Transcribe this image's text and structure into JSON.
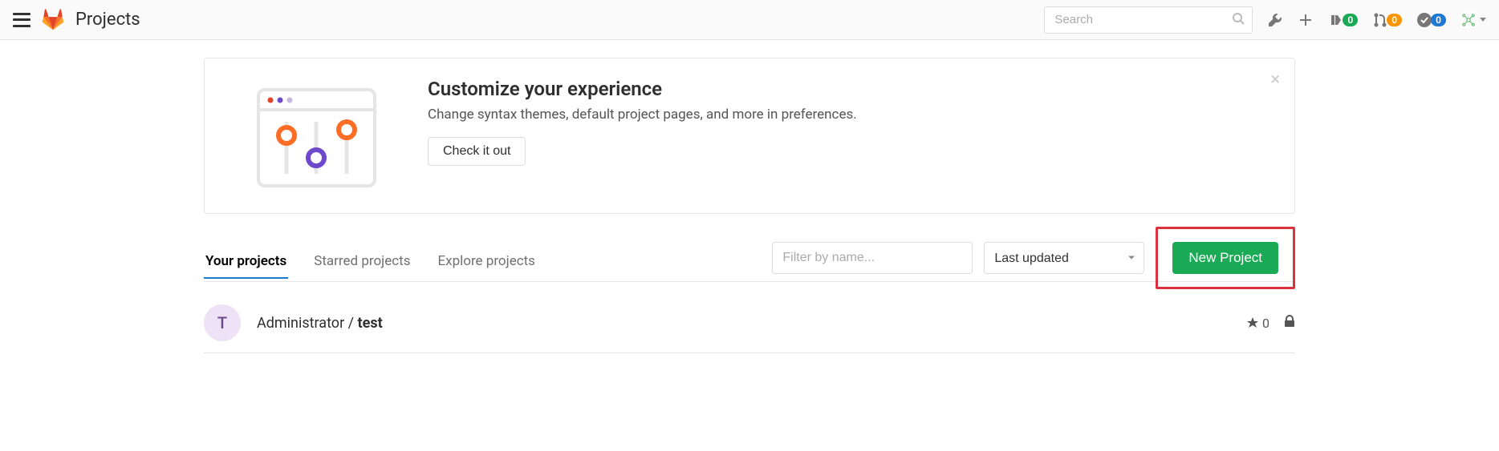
{
  "header": {
    "page_title": "Projects",
    "search_placeholder": "Search",
    "badges": {
      "issues": "0",
      "merge_requests": "0",
      "todos": "0"
    }
  },
  "banner": {
    "title": "Customize your experience",
    "desc": "Change syntax themes, default project pages, and more in preferences.",
    "button": "Check it out"
  },
  "tabs": {
    "your_projects": "Your projects",
    "starred_projects": "Starred projects",
    "explore_projects": "Explore projects"
  },
  "controls": {
    "filter_placeholder": "Filter by name...",
    "sort_value": "Last updated",
    "new_project": "New Project"
  },
  "projects": [
    {
      "avatar_letter": "T",
      "owner": "Administrator",
      "name": "test",
      "stars": "0"
    }
  ]
}
